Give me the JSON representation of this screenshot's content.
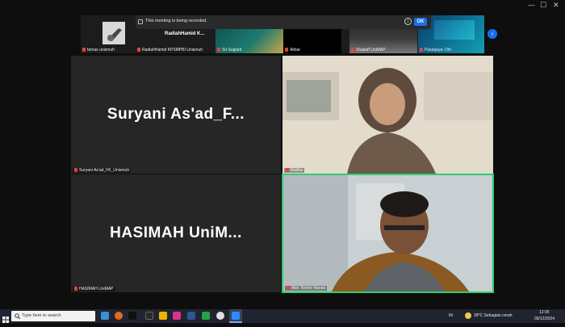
{
  "window_controls": {
    "minimize": "—",
    "maximize": "☐",
    "close": "✕"
  },
  "recording": {
    "text": "This meeting is being recorded.",
    "ok_label": "OK",
    "info": "i"
  },
  "thumbnails": [
    {
      "name": "famas unismuh",
      "muted": true
    },
    {
      "name": "RadiahHamid KPSMPBI Unismuh",
      "muted": true,
      "display_text": "RadiahHamid  K..."
    },
    {
      "name": "Sri Sugiarti",
      "muted": true
    },
    {
      "name": "Akbar",
      "muted": true
    },
    {
      "name": "Shakaff UniMAP",
      "muted": true
    },
    {
      "name": "Pasarjaya- Dhi",
      "muted": true
    }
  ],
  "tiles": [
    {
      "name": "Suryani As'ad_FK_Unismuh",
      "big_label": "Suryani  As'ad_F..."
    },
    {
      "name": "Rudha"
    },
    {
      "name": "HASIMAH UniMAP",
      "big_label": "HASIMAH  UniM..."
    },
    {
      "name": "Abd. Rahim Nanda"
    }
  ],
  "next_arrow": "›",
  "taskbar": {
    "search_placeholder": "Type here to search",
    "language": "IN",
    "weather": "28°C  Sebagian cerah",
    "time": "12:05",
    "date": "09/12/2024"
  }
}
